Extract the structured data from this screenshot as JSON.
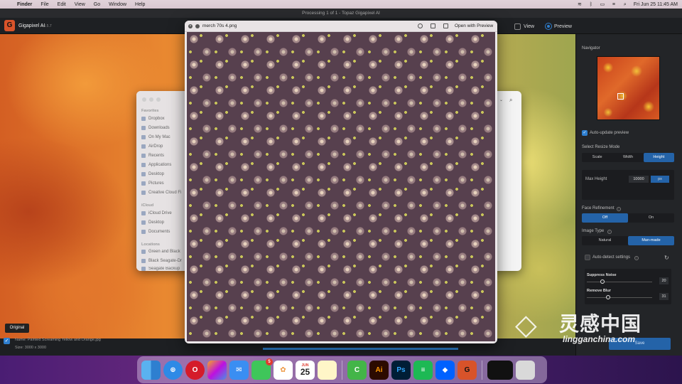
{
  "menubar": {
    "app": "Finder",
    "items": [
      "File",
      "Edit",
      "View",
      "Go",
      "Window",
      "Help"
    ],
    "clock": "Fri Jun 25  11:45 AM"
  },
  "app": {
    "window_title": "Processing 1 of 1 - Topaz Gigapixel AI",
    "name": "Gigapixel AI",
    "version": "v5.5.7",
    "view_label": "View",
    "preview_label": "Preview",
    "original_badge": "Original",
    "info_name": "Name: Painted Screaming Yellow and Orange.jpg",
    "info_size": "Size: 3000 x 3000",
    "save_label": "Save"
  },
  "panel": {
    "navigator": "Navigator",
    "auto_update": "Auto-update preview",
    "resize_mode_label": "Select Resize Mode",
    "resize_modes": [
      "Scale",
      "Width",
      "Height"
    ],
    "resize_selected": "Height",
    "max_height_label": "Max Height",
    "max_height_value": "10000",
    "max_height_unit": "px",
    "face_label": "Face Refinement",
    "face_options": [
      "Off",
      "On"
    ],
    "image_type_label": "Image Type",
    "image_types": [
      "Natural",
      "Man-made"
    ],
    "auto_detect": "Auto-detect settings",
    "suppress_noise": "Suppress Noise",
    "suppress_noise_value": "20",
    "remove_blur": "Remove Blur",
    "remove_blur_value": "31"
  },
  "finder": {
    "favorites_head": "Favorites",
    "favorites": [
      "Dropbox",
      "Downloads",
      "On My Mac",
      "AirDrop",
      "Recents",
      "Applications",
      "Desktop",
      "Pictures",
      "Creative Cloud Fi"
    ],
    "icloud_head": "iCloud",
    "icloud": [
      "iCloud Drive",
      "Desktop",
      "Documents"
    ],
    "locations_head": "Locations",
    "locations": [
      "Green and Black",
      "Black Seagate-Dr",
      "Seagate Backup"
    ]
  },
  "quicklook": {
    "title": "merch 70s 4.png",
    "open_with": "Open with Preview"
  },
  "dock": {
    "messages_badge": "5",
    "calendar_month": "JUN",
    "calendar_day": "25"
  },
  "watermark": {
    "cn": "灵感中国",
    "en": "lingganchina.com"
  }
}
